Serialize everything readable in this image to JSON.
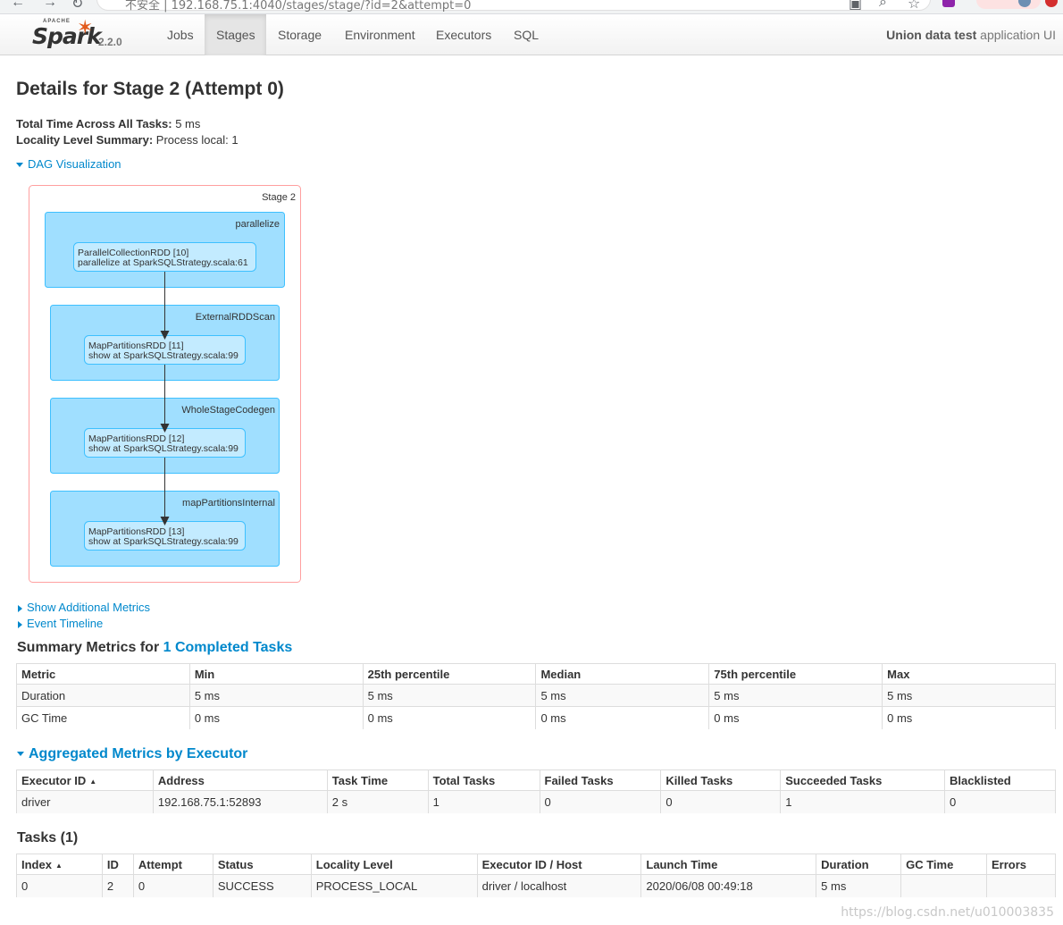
{
  "browser": {
    "url": "不安全 | 192.168.75.1:4040/stages/stage/?id=2&attempt=0"
  },
  "navbar": {
    "brand_apache": "APACHE",
    "brand_spark": "Spark",
    "brand_version": "2.2.0",
    "tabs": [
      {
        "label": "Jobs",
        "active": false
      },
      {
        "label": "Stages",
        "active": true
      },
      {
        "label": "Storage",
        "active": false
      },
      {
        "label": "Environment",
        "active": false
      },
      {
        "label": "Executors",
        "active": false
      },
      {
        "label": "SQL",
        "active": false
      }
    ],
    "app_name_bold": "Union data test",
    "app_name_rest": " application UI"
  },
  "page": {
    "title": "Details for Stage 2 (Attempt 0)",
    "total_time_label": "Total Time Across All Tasks:",
    "total_time_value": " 5 ms",
    "locality_label": "Locality Level Summary:",
    "locality_value": " Process local: 1",
    "dag_toggle": "DAG Visualization",
    "show_metrics": "Show Additional Metrics",
    "event_timeline": "Event Timeline"
  },
  "dag": {
    "stage_label": "Stage 2",
    "clusters": [
      {
        "name": "parallelize",
        "rdd": "ParallelCollectionRDD [10]",
        "callsite": "parallelize at SparkSQLStrategy.scala:61"
      },
      {
        "name": "ExternalRDDScan",
        "rdd": "MapPartitionsRDD [11]",
        "callsite": "show at SparkSQLStrategy.scala:99"
      },
      {
        "name": "WholeStageCodegen",
        "rdd": "MapPartitionsRDD [12]",
        "callsite": "show at SparkSQLStrategy.scala:99"
      },
      {
        "name": "mapPartitionsInternal",
        "rdd": "MapPartitionsRDD [13]",
        "callsite": "show at SparkSQLStrategy.scala:99"
      }
    ]
  },
  "summary": {
    "heading_prefix": "Summary Metrics for ",
    "heading_link": "1 Completed Tasks",
    "headers": [
      "Metric",
      "Min",
      "25th percentile",
      "Median",
      "75th percentile",
      "Max"
    ],
    "rows": [
      [
        "Duration",
        "5 ms",
        "5 ms",
        "5 ms",
        "5 ms",
        "5 ms"
      ],
      [
        "GC Time",
        "0 ms",
        "0 ms",
        "0 ms",
        "0 ms",
        "0 ms"
      ]
    ]
  },
  "aggregated": {
    "heading": "Aggregated Metrics by Executor",
    "headers": [
      "Executor ID",
      "Address",
      "Task Time",
      "Total Tasks",
      "Failed Tasks",
      "Killed Tasks",
      "Succeeded Tasks",
      "Blacklisted"
    ],
    "sort_arrow": "▲",
    "rows": [
      [
        "driver",
        "192.168.75.1:52893",
        "2 s",
        "1",
        "0",
        "0",
        "1",
        "0"
      ]
    ]
  },
  "tasks": {
    "heading": "Tasks (1)",
    "headers": [
      "Index",
      "ID",
      "Attempt",
      "Status",
      "Locality Level",
      "Executor ID / Host",
      "Launch Time",
      "Duration",
      "GC Time",
      "Errors"
    ],
    "sort_arrow": "▲",
    "rows": [
      [
        "0",
        "2",
        "0",
        "SUCCESS",
        "PROCESS_LOCAL",
        "driver / localhost",
        "2020/06/08 00:49:18",
        "5 ms",
        "",
        ""
      ]
    ]
  },
  "watermark": "https://blog.csdn.net/u010003835",
  "colors": {
    "link": "#0088cc",
    "cluster_fill": "#a0dfff",
    "cluster_stroke": "#3ec0ff",
    "node_fill": "#c3ebff",
    "stage_stroke": "#ffa0a0",
    "spark_orange": "#e25a1c"
  }
}
